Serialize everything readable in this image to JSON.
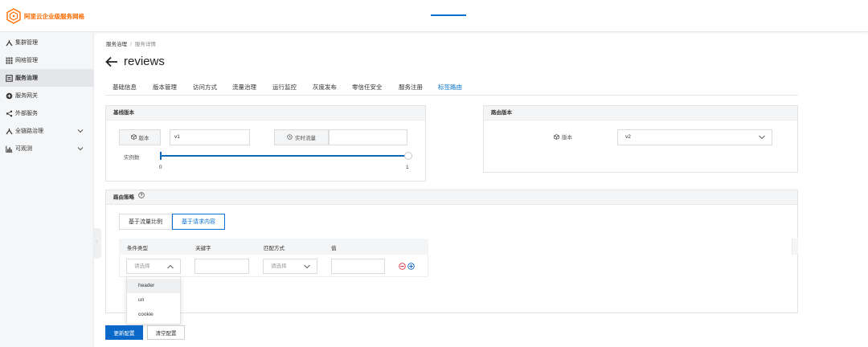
{
  "app": {
    "logo_text": "阿里云企业级服务网格"
  },
  "sidebar": {
    "items": [
      {
        "label": "集群管理",
        "icon": "cluster-icon"
      },
      {
        "label": "网格管理",
        "icon": "grid-icon"
      },
      {
        "label": "服务治理",
        "icon": "service-icon",
        "active": true
      },
      {
        "label": "服务网关",
        "icon": "gateway-icon"
      },
      {
        "label": "外部服务",
        "icon": "share-icon"
      },
      {
        "label": "全链路治理",
        "icon": "trace-icon",
        "expandable": true
      },
      {
        "label": "可观测",
        "icon": "chart-icon",
        "expandable": true
      }
    ]
  },
  "breadcrumb": {
    "root": "服务治理",
    "separator": "/",
    "current": "服务详情"
  },
  "page": {
    "title": "reviews"
  },
  "tabs": [
    "基础信息",
    "版本管理",
    "访问方式",
    "流量治理",
    "运行监控",
    "灰度发布",
    "零信任安全",
    "服务注册",
    "标签路由"
  ],
  "active_tab": "标签路由",
  "baseline_panel": {
    "title": "基线版本",
    "version_label": "版本",
    "version_value": "v1",
    "traffic_label": "实时流量",
    "traffic_value": "",
    "instances_label": "实例数",
    "slider_min": "0",
    "slider_max": "1",
    "slider_value": 1
  },
  "routing_version_panel": {
    "title": "路由版本",
    "version_label": "版本",
    "version_value": "v2"
  },
  "policy_panel": {
    "title": "路由策略",
    "mode_buttons": [
      "基于流量比例",
      "基于请求内容"
    ],
    "active_mode": "基于请求内容",
    "table_headers": [
      "条件类型",
      "关键字",
      "匹配方式",
      "值"
    ],
    "row": {
      "condition_type_placeholder": "请选择",
      "keyword": "",
      "match_placeholder": "请选择",
      "value": ""
    },
    "condition_options": [
      "header",
      "uri",
      "cookie"
    ]
  },
  "footer": {
    "update_button": "更新配置",
    "clear_button": "清空配置"
  },
  "colors": {
    "brand": "#ff6a00",
    "primary": "#0a68c8",
    "active_tab": "#0070cc",
    "remove": "#d9363e"
  }
}
